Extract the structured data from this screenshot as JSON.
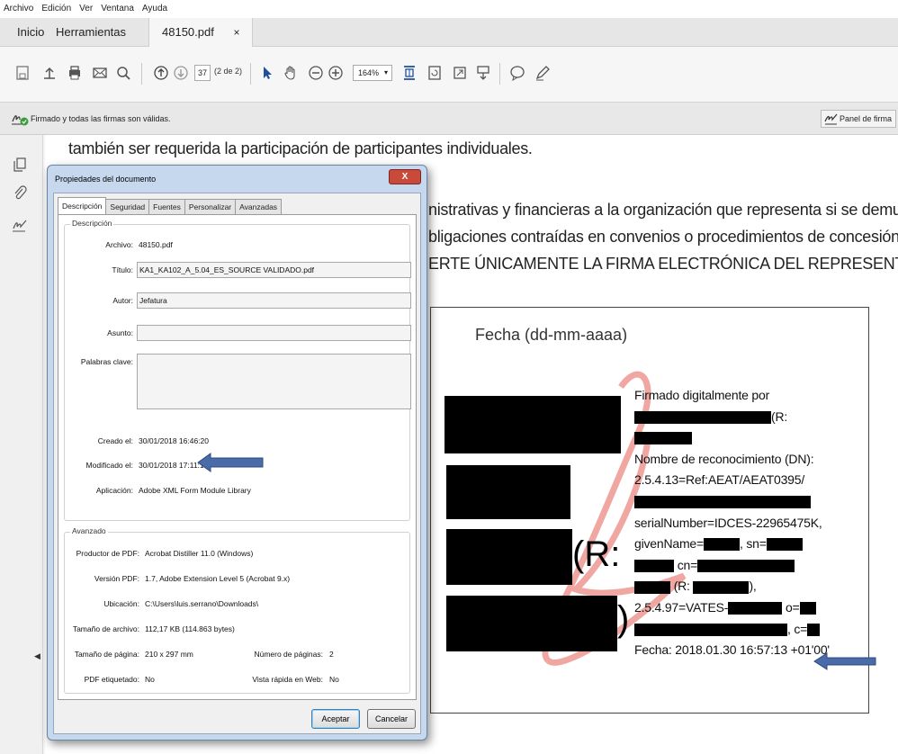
{
  "menu": [
    "Archivo",
    "Edición",
    "Ver",
    "Ventana",
    "Ayuda"
  ],
  "tabs": {
    "home": "Inicio",
    "tools": "Herramientas",
    "doc": "48150.pdf",
    "close": "×"
  },
  "toolbar": {
    "page_current": "37",
    "page_count": "(2 de 2)",
    "zoom": "164%"
  },
  "signature_bar": {
    "message": "Firmado y todas las firmas son válidas.",
    "panel_button": "Panel de firma"
  },
  "document": {
    "line1": "también ser requerida la participación de participantes individuales.",
    "line2": "nistrativas y financieras a la organización que representa si se demuestra",
    "line3": "bligaciones contraídas en convenios o procedimientos de concesión de",
    "line4": "ERTE ÚNICAMENTE LA FIRMA ELECTRÓNICA DEL REPRESENTANTE LEGAL.",
    "fecha_label": "Fecha (dd-mm-aaaa)",
    "r_label": "(R:",
    "paren": ")",
    "cert": {
      "l1": "Firmado digitalmente por",
      "l2": "(R:",
      "l4": "Nombre de reconocimiento (DN):",
      "l5": "2.5.4.13=Ref:AEAT/AEAT0395/",
      "l7": "serialNumber=IDCES-22965475K,",
      "l8a": "givenName=",
      "l8b": ", sn=",
      "l9": " cn=",
      "l10a": " (R: ",
      "l10b": "),",
      "l11a": "2.5.4.97=VATES-",
      "l11b": " o=",
      "l12": ", c=",
      "l13": "Fecha: 2018.01.30 16:57:13 +01'00'"
    }
  },
  "dialog": {
    "title": "Propiedades del documento",
    "close": "X",
    "tabs": [
      "Descripción",
      "Seguridad",
      "Fuentes",
      "Personalizar",
      "Avanzadas"
    ],
    "description": {
      "group": "Descripción",
      "archivo_label": "Archivo:",
      "archivo": "48150.pdf",
      "titulo_label": "Título:",
      "titulo": "KA1_KA102_A_5.04_ES_SOURCE VALIDADO.pdf",
      "autor_label": "Autor:",
      "autor": "Jefatura",
      "asunto_label": "Asunto:",
      "asunto": "",
      "palabras_label": "Palabras clave:",
      "palabras": "",
      "creado_label": "Creado el:",
      "creado": "30/01/2018 16:46:20",
      "modificado_label": "Modificado el:",
      "modificado": "30/01/2018 17:11:19",
      "aplicacion_label": "Aplicación:",
      "aplicacion": "Adobe XML Form Module Library"
    },
    "advanced": {
      "group": "Avanzado",
      "productor_label": "Productor de PDF:",
      "productor": "Acrobat Distiller 11.0 (Windows)",
      "version_label": "Versión PDF:",
      "version": "1.7, Adobe Extension Level 5 (Acrobat 9.x)",
      "ubicacion_label": "Ubicación:",
      "ubicacion": "C:\\Users\\luis.serrano\\Downloads\\",
      "tamano_archivo_label": "Tamaño de archivo:",
      "tamano_archivo": "112,17 KB (114.863 bytes)",
      "tamano_pagina_label": "Tamaño de página:",
      "tamano_pagina": "210 x 297 mm",
      "num_paginas_label": "Número de páginas:",
      "num_paginas": "2",
      "etiquetado_label": "PDF etiquetado:",
      "etiquetado": "No",
      "vista_label": "Vista rápida en Web:",
      "vista": "No"
    },
    "ok": "Aceptar",
    "cancel": "Cancelar"
  },
  "colors": {
    "arrow": "#4a6aa8",
    "dialog_frame": "#c6d8ee",
    "close_red": "#c9493a",
    "acrobat_red": "#e8463a"
  }
}
